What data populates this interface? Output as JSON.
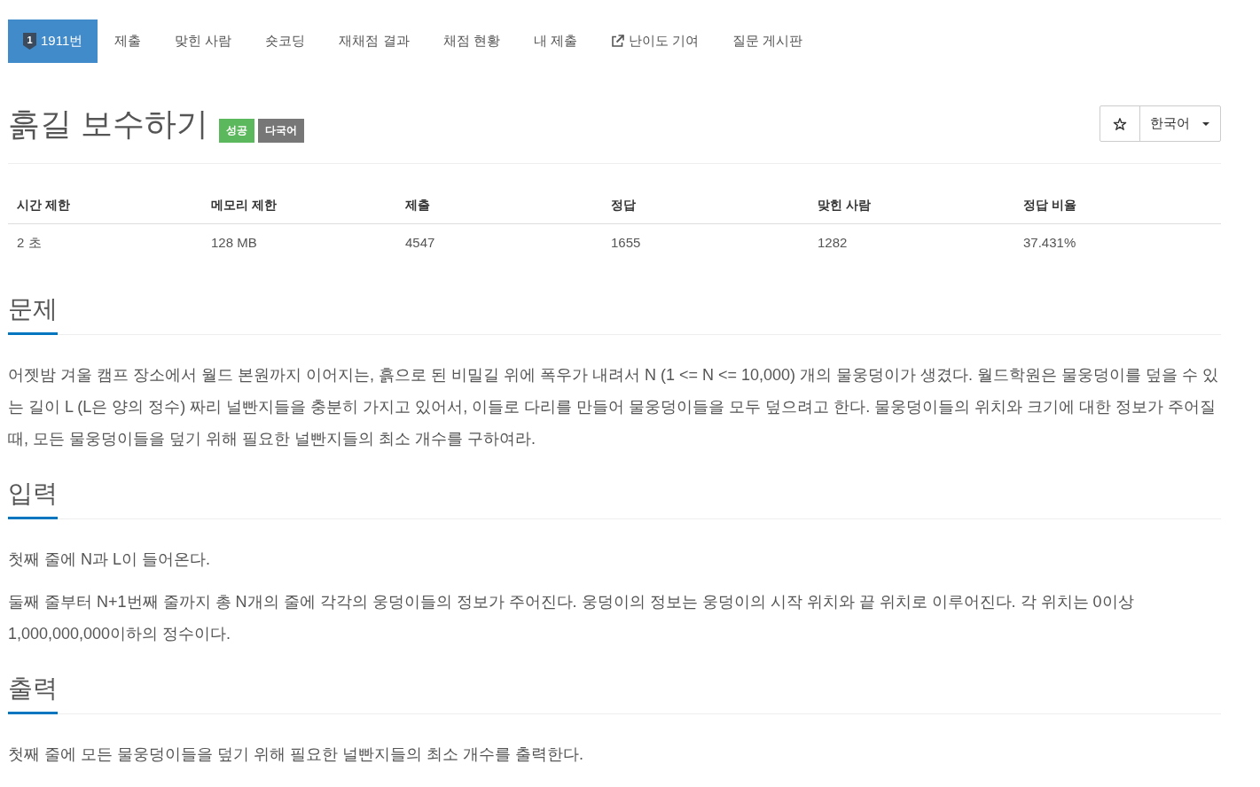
{
  "nav": {
    "tabs": [
      {
        "label": "1911번",
        "kind": "problem",
        "badge": "1",
        "selected": true
      },
      {
        "label": "제출",
        "kind": "link",
        "selected": false
      },
      {
        "label": "맞힌 사람",
        "kind": "link",
        "selected": false
      },
      {
        "label": "숏코딩",
        "kind": "link",
        "selected": false
      },
      {
        "label": "재채점 결과",
        "kind": "link",
        "selected": false
      },
      {
        "label": "채점 현황",
        "kind": "link",
        "selected": false
      },
      {
        "label": "내 제출",
        "kind": "link",
        "selected": false
      },
      {
        "label": "난이도 기여",
        "kind": "external",
        "selected": false
      },
      {
        "label": "질문 게시판",
        "kind": "link",
        "selected": false
      }
    ]
  },
  "problem": {
    "title": "흙길 보수하기",
    "labels": [
      {
        "text": "성공",
        "color": "#5cb85c"
      },
      {
        "text": "다국어",
        "color": "#777777"
      }
    ],
    "starred": false,
    "language": "한국어"
  },
  "stats": {
    "columns": [
      "시간 제한",
      "메모리 제한",
      "제출",
      "정답",
      "맞힌 사람",
      "정답 비율"
    ],
    "rows": [
      [
        "2 초",
        "128 MB",
        "4547",
        "1655",
        "1282",
        "37.431%"
      ]
    ]
  },
  "sections": [
    {
      "heading": "문제",
      "paragraphs": [
        "어젯밤 겨울 캠프 장소에서 월드 본원까지 이어지는, 흙으로 된 비밀길 위에 폭우가 내려서 N (1 <= N <= 10,000) 개의 물웅덩이가 생겼다. 월드학원은 물웅덩이를 덮을 수 있는 길이 L (L은 양의 정수) 짜리 널빤지들을 충분히 가지고 있어서, 이들로 다리를 만들어 물웅덩이들을 모두 덮으려고 한다. 물웅덩이들의 위치와 크기에 대한 정보가 주어질 때, 모든 물웅덩이들을 덮기 위해 필요한 널빤지들의 최소 개수를 구하여라."
      ]
    },
    {
      "heading": "입력",
      "paragraphs": [
        "첫째 줄에 N과 L이 들어온다.",
        "둘째 줄부터 N+1번째 줄까지 총 N개의 줄에 각각의 웅덩이들의 정보가 주어진다. 웅덩이의 정보는 웅덩이의 시작 위치와 끝 위치로 이루어진다. 각 위치는 0이상 1,000,000,000이하의 정수이다."
      ]
    },
    {
      "heading": "출력",
      "paragraphs": [
        "첫째 줄에 모든 물웅덩이들을 덮기 위해 필요한 널빤지들의 최소 개수를 출력한다."
      ]
    }
  ]
}
